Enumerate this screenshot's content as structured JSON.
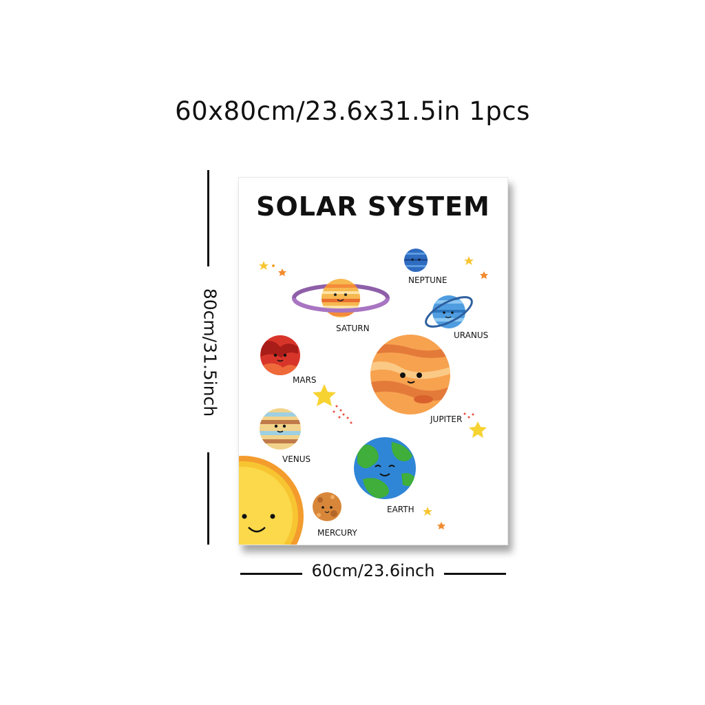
{
  "header": {
    "dimensions_label": "60x80cm/23.6x31.5in 1pcs"
  },
  "dimension_marks": {
    "height_label": "80cm/31.5inch",
    "width_label": "60cm/23.6inch"
  },
  "poster": {
    "title": "SOLAR SYSTEM",
    "planets": {
      "neptune": "NEPTUNE",
      "saturn": "SATURN",
      "uranus": "URANUS",
      "mars": "MARS",
      "jupiter": "JUPITER",
      "venus": "VENUS",
      "earth": "EARTH",
      "mercury": "MERCURY"
    }
  }
}
